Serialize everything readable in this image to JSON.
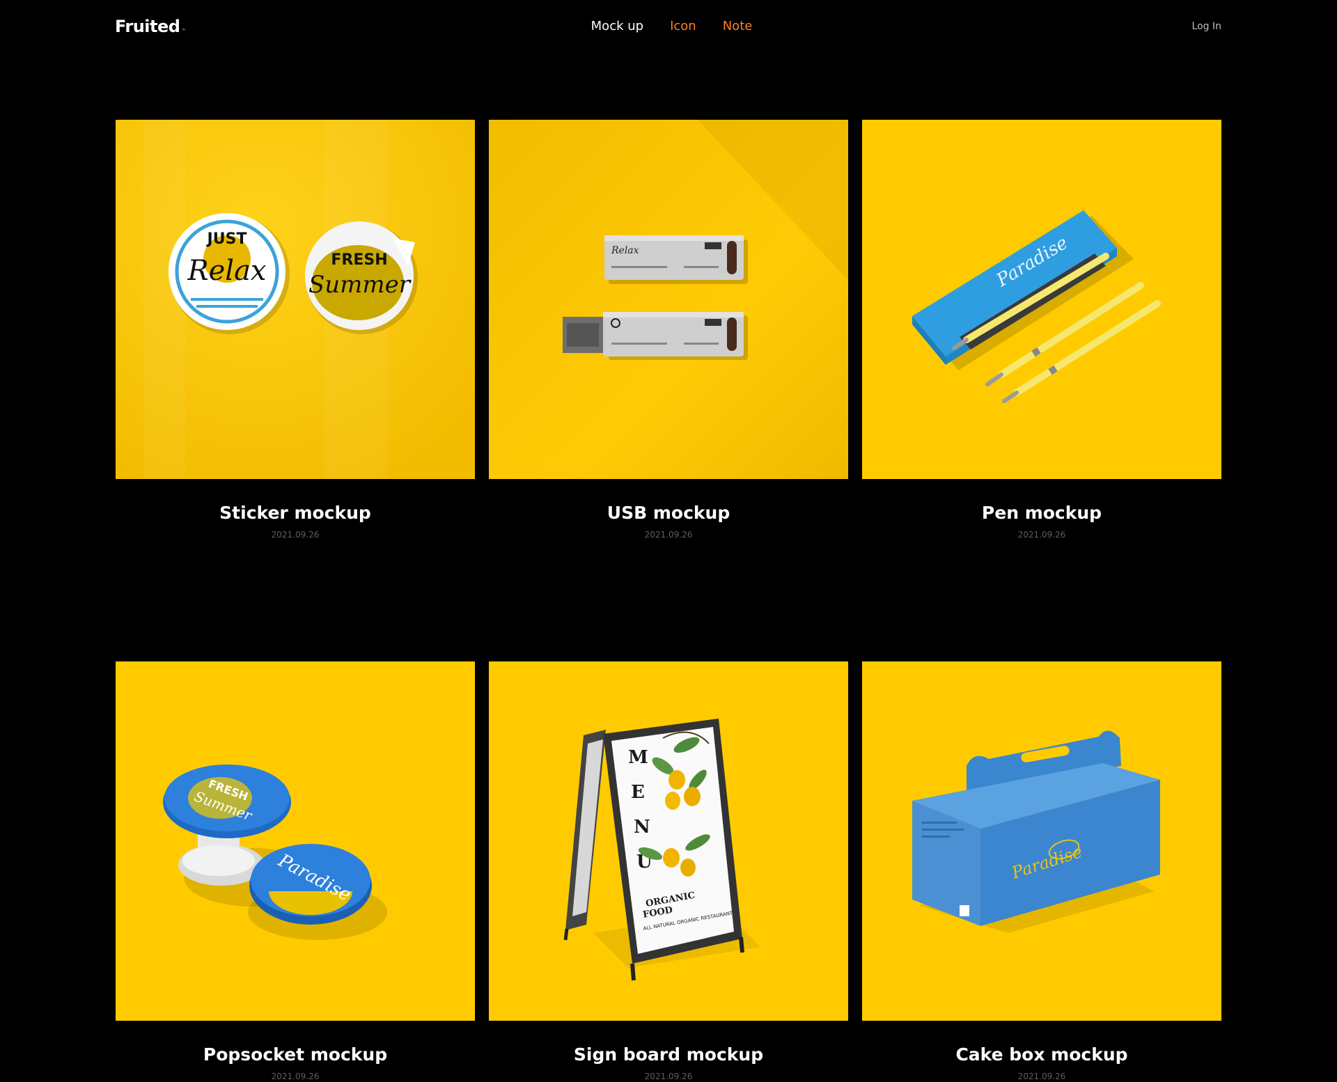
{
  "header": {
    "logo": "Fruited",
    "logo_mark": "™",
    "nav": [
      {
        "label": "Mock up",
        "color": "#ffffff"
      },
      {
        "label": "Icon",
        "color": "#ff7f26"
      },
      {
        "label": "Note",
        "color": "#ff7f26"
      }
    ],
    "login": "Log In"
  },
  "theme": {
    "background": "#000000",
    "card_background": "#ffcb00",
    "accent": "#ff7f26",
    "product_blue": "#2f9ee0"
  },
  "cards": [
    {
      "title": "Sticker mockup",
      "date": "2021.09.26",
      "image": {
        "subject": "two round stickers",
        "texts": {
          "line1": "JUST",
          "line2": "Relax",
          "line3": "FRESH",
          "line4": "Summer"
        }
      }
    },
    {
      "title": "USB mockup",
      "date": "2021.09.26",
      "image": {
        "subject": "USB stick and cap",
        "texts": {
          "brand": "Relax"
        }
      }
    },
    {
      "title": "Pen mockup",
      "date": "2021.09.26",
      "image": {
        "subject": "blue pen case with yellow pens",
        "texts": {
          "brand": "Paradise"
        }
      }
    },
    {
      "title": "Popsocket mockup",
      "date": "2021.09.26",
      "image": {
        "subject": "two blue popsockets",
        "texts": {
          "line1": "FRESH",
          "line2": "Summer",
          "line3": "Paradise"
        }
      }
    },
    {
      "title": "Sign board mockup",
      "date": "2021.09.26",
      "image": {
        "subject": "A-frame menu sign board",
        "texts": {
          "menu": [
            "M",
            "E",
            "N",
            "U"
          ],
          "line1": "ORGANIC",
          "line2": "FOOD",
          "line3": "ALL NATURAL ORGANIC RESTAURANT"
        }
      }
    },
    {
      "title": "Cake box mockup",
      "date": "2021.09.26",
      "image": {
        "subject": "blue cake box with handle",
        "texts": {
          "brand": "Paradise"
        }
      }
    }
  ]
}
